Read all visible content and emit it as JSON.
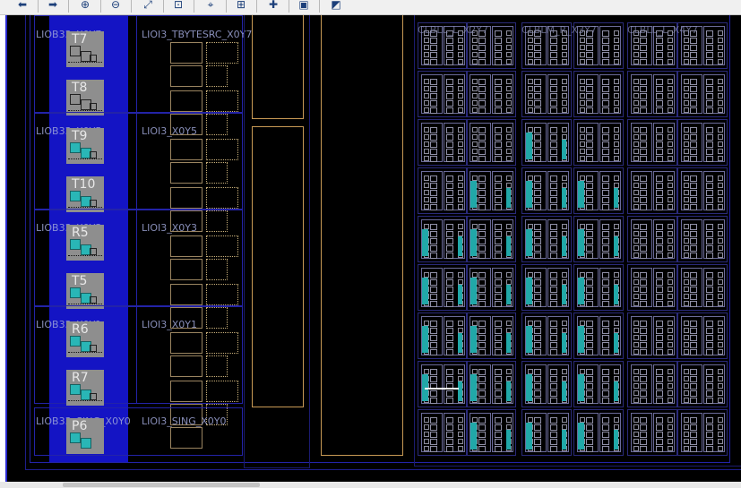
{
  "toolbar": {
    "buttons": [
      {
        "name": "back-button",
        "icon": "arrow-left-icon",
        "glyph": "⬅"
      },
      {
        "name": "forward-button",
        "icon": "arrow-right-icon",
        "glyph": "➡"
      },
      {
        "name": "zoom-in-button",
        "icon": "zoom-in-icon",
        "glyph": "⊕"
      },
      {
        "name": "zoom-out-button",
        "icon": "zoom-out-icon",
        "glyph": "⊖"
      },
      {
        "name": "zoom-fit-button",
        "icon": "zoom-fit-icon",
        "glyph": "⤢"
      },
      {
        "name": "zoom-selected-button",
        "icon": "zoom-selected-icon",
        "glyph": "⊡"
      },
      {
        "name": "route-button",
        "icon": "route-icon",
        "glyph": "⌖"
      },
      {
        "name": "hierarchy-button",
        "icon": "hierarchy-icon",
        "glyph": "⊞"
      },
      {
        "name": "add-pblock-button",
        "icon": "add-pblock-icon",
        "glyph": "✚"
      },
      {
        "name": "layers-button",
        "icon": "layers-icon",
        "glyph": "▣"
      },
      {
        "name": "select-area-button",
        "icon": "select-area-icon",
        "glyph": "◩"
      }
    ]
  },
  "tiles": [
    {
      "iob": "LIOB33_X0Y7",
      "ioi": "LIOI3_TBYTESRC_X0Y7",
      "pads": [
        "T7",
        "T8"
      ],
      "cyan": [
        false,
        false
      ]
    },
    {
      "iob": "LIOB33_X0Y5",
      "ioi": "LIOI3_X0Y5",
      "pads": [
        "T9",
        "T10"
      ],
      "cyan": [
        true,
        true
      ]
    },
    {
      "iob": "LIOB33_X0Y3",
      "ioi": "LIOI3_X0Y3",
      "pads": [
        "R5",
        "T5"
      ],
      "cyan": [
        true,
        true
      ]
    },
    {
      "iob": "LIOB33_X0Y1",
      "ioi": "LIOI3_X0Y1",
      "pads": [
        "R6",
        "R7"
      ],
      "cyan": [
        true,
        true
      ]
    }
  ],
  "single_tile": {
    "iob": "LIOB33_SING_X0Y0",
    "ioi": "LIOI3_SING_X0Y0",
    "pad": "P6"
  },
  "clb_labels": [
    "CLBLL_L_X2Y7",
    "CLBLM_R_X3Y7",
    "CLBLL_L_X4Y7"
  ],
  "colors": {
    "iob_blue": "#1414c4",
    "cyan_fill": "#21a8a8",
    "io_border": "#c89a55",
    "canvas": "#000000"
  }
}
